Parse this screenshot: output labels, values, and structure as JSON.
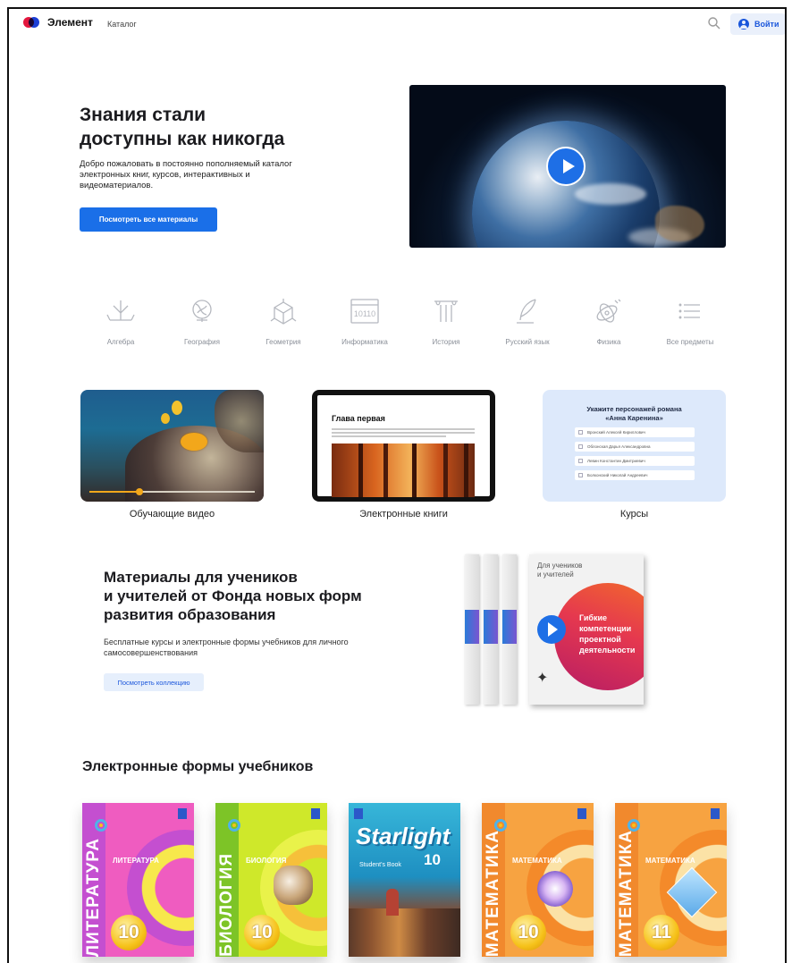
{
  "header": {
    "logo": "Элемент",
    "nav_catalog": "Каталог",
    "login_label": "Войти"
  },
  "hero": {
    "title": "Знания стали\nдоступны как никогда",
    "description": "Добро пожаловать в постоянно пополняемый каталог электронных книг, курсов, интерактивных и видеоматериалов.",
    "button_label": "Посмотреть все материалы"
  },
  "subjects": [
    {
      "label": "Алгебра",
      "icon": "algebra-icon"
    },
    {
      "label": "География",
      "icon": "globe-icon"
    },
    {
      "label": "Геометрия",
      "icon": "cube-icon"
    },
    {
      "label": "Информатика",
      "icon": "binary-screen-icon",
      "glyph": "10110"
    },
    {
      "label": "История",
      "icon": "column-icon"
    },
    {
      "label": "Русский язык",
      "icon": "quill-icon"
    },
    {
      "label": "Физика",
      "icon": "atom-icon"
    },
    {
      "label": "Все предметы",
      "icon": "list-icon"
    }
  ],
  "features": {
    "video_label": "Обучающие видео",
    "video_progress": 0.3,
    "books_label": "Электронные книги",
    "book_chapter": "Глава первая",
    "courses_label": "Курсы",
    "course_question": "Укажите персонажей романа\n«Анна Каренина»",
    "course_options": [
      "Вронский Алексей Кириллович",
      "Облонская Дарья Александровна",
      "Левин Константин Дмитриевич",
      "Болконский Николай Андреевич"
    ]
  },
  "foundation": {
    "title": "Материалы для учеников\nи учителей от Фонда новых форм\nразвития образования",
    "description": "Бесплатные курсы и электронные формы учебников для личного самосовершенствования",
    "button_label": "Посмотреть коллекцию",
    "book_top": "Для учеников\nи учителей",
    "book_title": "Гибкие\nкомпетенции\nпроектной\nдеятельности"
  },
  "textbooks": {
    "title": "Электронные формы учебников",
    "items": [
      {
        "spine": "ЛИТЕРАТУРА",
        "subtitle": "ЛИТЕРАТУРА",
        "grade": "10"
      },
      {
        "spine": "БИОЛОГИЯ",
        "subtitle": "БИОЛОГИЯ",
        "grade": "10"
      },
      {
        "title": "Starlight",
        "grade": "10",
        "subtitle": "Student's Book"
      },
      {
        "spine": "МАТЕМАТИКА",
        "subtitle": "МАТЕМАТИКА",
        "grade": "10"
      },
      {
        "spine": "МАТЕМАТИКА",
        "subtitle": "МАТЕМАТИКА",
        "grade": "11"
      }
    ]
  }
}
